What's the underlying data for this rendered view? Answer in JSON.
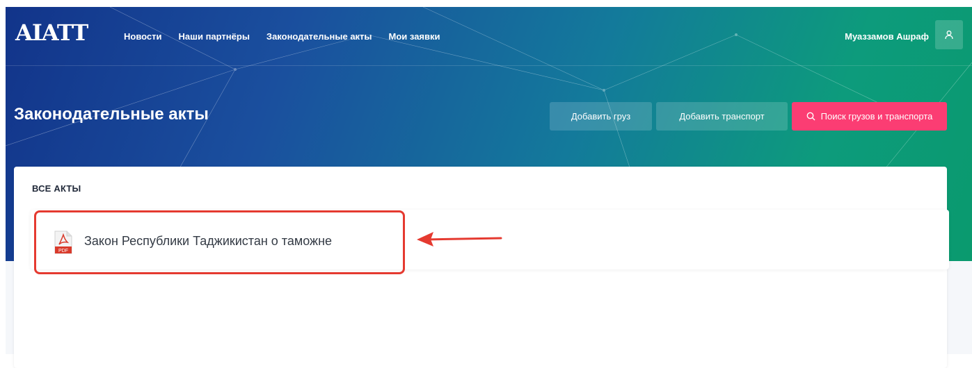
{
  "header": {
    "logo": "AIATT",
    "nav": [
      "Новости",
      "Наши партнёры",
      "Законодательные акты",
      "Мои заявки"
    ],
    "user_name": "Муаззамов Ашраф",
    "user_icon": "user-icon"
  },
  "page": {
    "title": "Законодательные акты",
    "buttons": {
      "add_cargo": "Добавить груз",
      "add_transport": "Добавить транспорт",
      "search": "Поиск грузов и транспорта",
      "search_icon": "search-icon"
    }
  },
  "acts": {
    "section_title": "ВСЕ АКТЫ",
    "items": [
      {
        "title": "Закон Республики Таджикистан о таможне",
        "icon": "pdf-icon",
        "icon_label": "PDF"
      }
    ]
  },
  "colors": {
    "accent": "#fb3d73",
    "gradient_start": "#12348a",
    "gradient_end": "#0a9a6e",
    "annotation": "#e53a30"
  }
}
